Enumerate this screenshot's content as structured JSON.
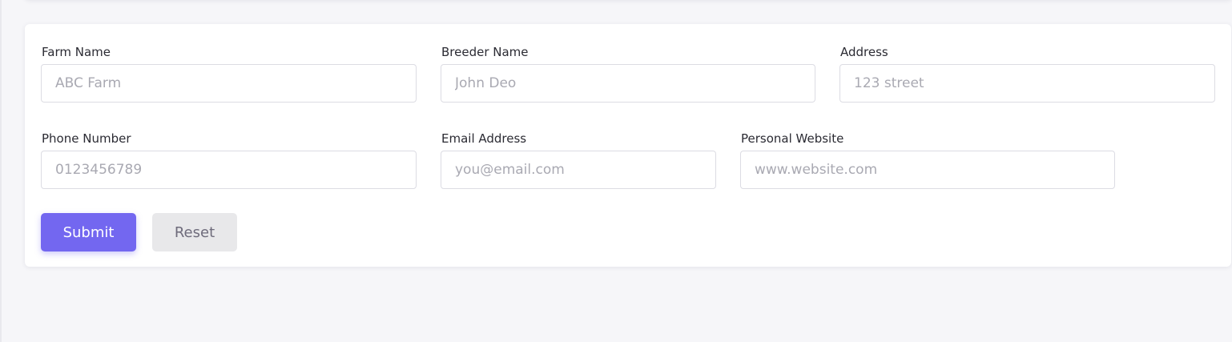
{
  "form": {
    "fields": [
      {
        "label": "Farm Name",
        "placeholder": "ABC Farm"
      },
      {
        "label": "Breeder Name",
        "placeholder": "John Deo"
      },
      {
        "label": "Address",
        "placeholder": "123 street"
      },
      {
        "label": "Phone Number",
        "placeholder": "0123456789"
      },
      {
        "label": "Email Address",
        "placeholder": "you@email.com"
      },
      {
        "label": "Personal Website",
        "placeholder": "www.website.com"
      }
    ],
    "buttons": {
      "submit_label": "Submit",
      "reset_label": "Reset"
    }
  },
  "colors": {
    "primary": "#7367f0",
    "secondary": "#e8e8ea",
    "page_background": "#f6f6f9"
  }
}
